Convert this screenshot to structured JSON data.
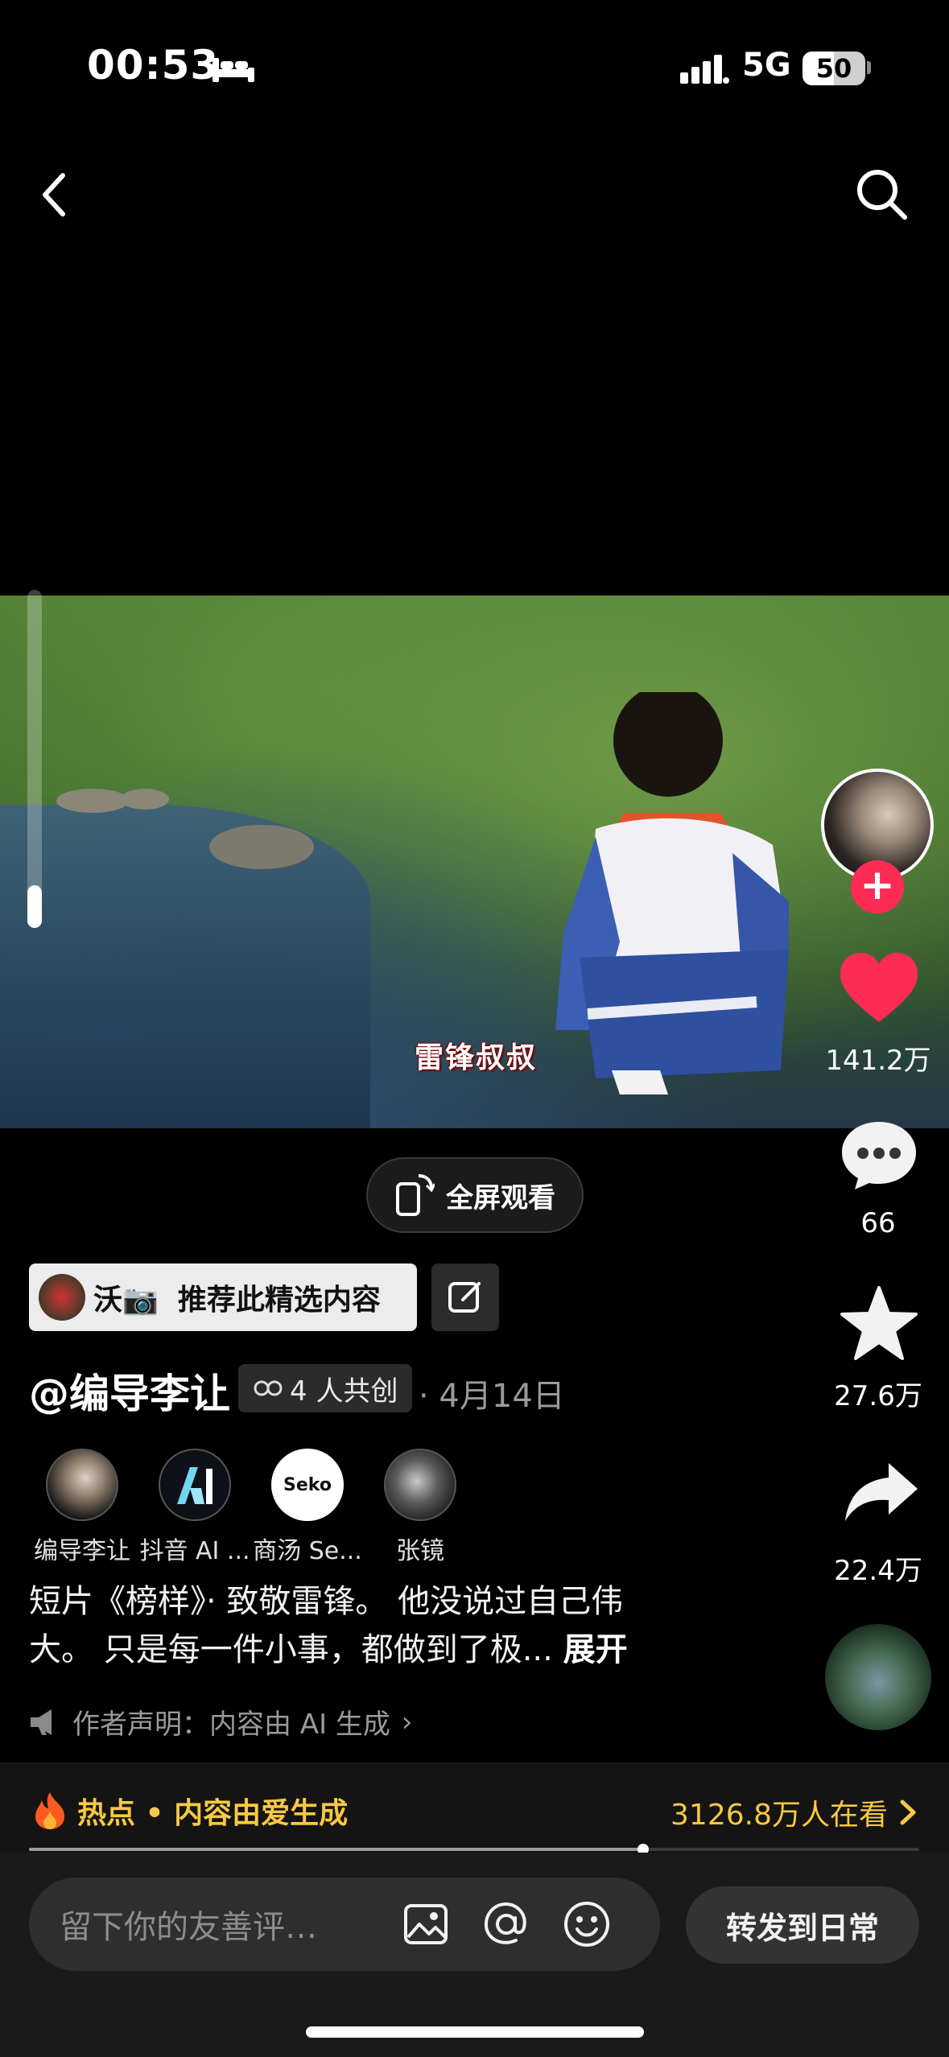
{
  "status": {
    "time": "00:53",
    "network": "5G",
    "battery": "50"
  },
  "video": {
    "subtitle": "雷锋叔叔"
  },
  "rail": {
    "likes": "141.2万",
    "comments": "66",
    "favorites": "27.6万",
    "shares": "22.4万"
  },
  "fullscreen": {
    "label": "全屏观看"
  },
  "recommend": {
    "user": "沃📷",
    "label": "推荐此精选内容"
  },
  "post": {
    "author": "@编导李让",
    "cocreate": "4 人共创",
    "date": "· 4月14日",
    "creators": [
      {
        "name": "编导李让"
      },
      {
        "name": "抖音 AI ..."
      },
      {
        "name": "商汤 Se..."
      },
      {
        "name": "张镜"
      }
    ],
    "seko_logo": "Seko",
    "description_line1": "短片《榜样》· 致敬雷锋。 他没说过自己伟",
    "description_line2": "大。 只是每一件小事，都做到了极...",
    "expand": "展开",
    "declaration": "作者声明：内容由 AI 生成"
  },
  "hot": {
    "label": "热点 • 内容由爱生成",
    "viewers": "3126.8万人在看",
    "progress": 0.69
  },
  "bottom": {
    "comment_placeholder": "留下你的友善评…",
    "share_label": "转发到日常"
  },
  "colors": {
    "accent": "#fe2c55",
    "hot": "#f7c843"
  }
}
